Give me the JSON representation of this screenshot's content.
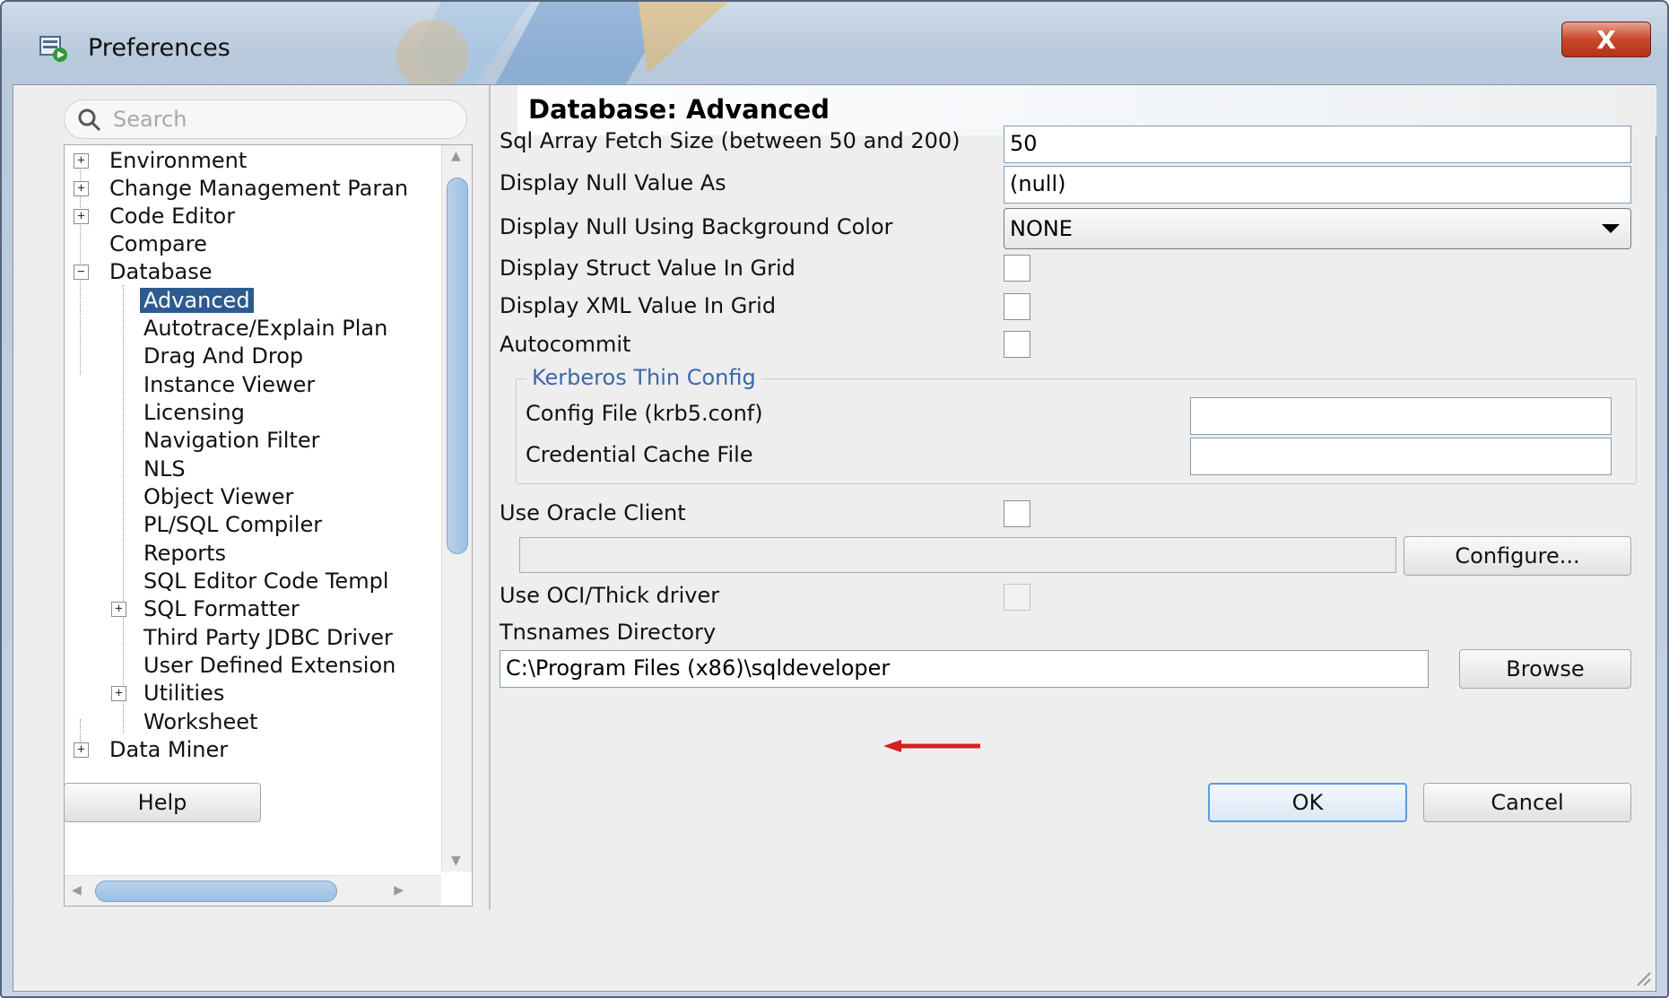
{
  "window": {
    "title": "Preferences",
    "close_label": "X"
  },
  "search": {
    "placeholder": "Search"
  },
  "tree": {
    "items": [
      {
        "label": "Environment"
      },
      {
        "label": "Change Management Paran"
      },
      {
        "label": "Code Editor"
      },
      {
        "label": "Compare"
      },
      {
        "label": "Database"
      },
      {
        "label": "Advanced"
      },
      {
        "label": "Autotrace/Explain Plan"
      },
      {
        "label": "Drag And Drop"
      },
      {
        "label": "Instance Viewer"
      },
      {
        "label": "Licensing"
      },
      {
        "label": "Navigation Filter"
      },
      {
        "label": "NLS"
      },
      {
        "label": "Object Viewer"
      },
      {
        "label": "PL/SQL Compiler"
      },
      {
        "label": "Reports"
      },
      {
        "label": "SQL Editor Code Templ"
      },
      {
        "label": "SQL Formatter"
      },
      {
        "label": "Third Party JDBC Driver"
      },
      {
        "label": "User Defined Extension"
      },
      {
        "label": "Utilities"
      },
      {
        "label": "Worksheet"
      },
      {
        "label": "Data Miner"
      }
    ],
    "expander_plus": "+",
    "expander_minus": "−"
  },
  "panel": {
    "title": "Database: Advanced",
    "fetch_size_label": "Sql Array Fetch Size (between 50 and 200)",
    "fetch_size_value": "50",
    "null_value_label": "Display Null Value As",
    "null_value_value": "(null)",
    "null_bg_label": "Display Null Using Background Color",
    "null_bg_value": "NONE",
    "struct_label": "Display Struct Value In Grid",
    "xml_label": "Display XML Value In Grid",
    "autocommit_label": "Autocommit",
    "kerberos_group": "Kerberos Thin Config",
    "config_file_label": "Config File (krb5.conf)",
    "config_file_value": "",
    "cred_cache_label": "Credential Cache File",
    "cred_cache_value": "",
    "oracle_client_label": "Use Oracle Client",
    "oracle_client_path": "",
    "configure_button": "Configure...",
    "oci_label": "Use OCI/Thick driver",
    "tnsnames_label": "Tnsnames Directory",
    "tnsnames_value": "C:\\Program Files (x86)\\sqldeveloper",
    "browse_button": "Browse"
  },
  "footer": {
    "help_button": "Help",
    "ok_button": "OK",
    "cancel_button": "Cancel"
  },
  "colors": {
    "selection": "#2e5b8f",
    "group_title": "#3b68a8",
    "annotation_arrow": "#d42020"
  }
}
